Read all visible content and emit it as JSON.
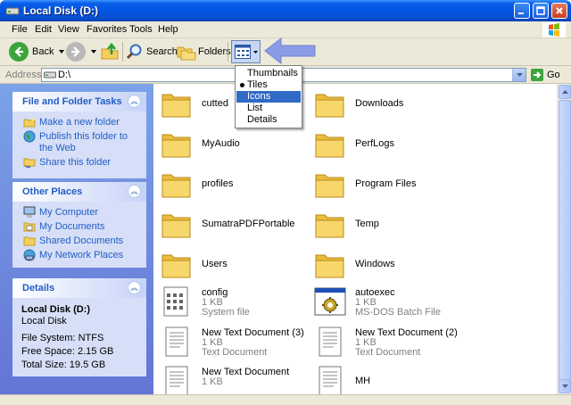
{
  "window": {
    "title": "Local Disk (D:)"
  },
  "menubar": {
    "items": [
      "File",
      "Edit",
      "View",
      "Favorites",
      "Tools",
      "Help"
    ]
  },
  "toolbar": {
    "back_label": "Back",
    "search_label": "Search",
    "folders_label": "Folders"
  },
  "address": {
    "label": "Address",
    "value": "D:\\",
    "go_label": "Go"
  },
  "views_menu": {
    "items": [
      "Thumbnails",
      "Tiles",
      "Icons",
      "List",
      "Details"
    ],
    "checked": "Tiles",
    "highlighted": "Icons"
  },
  "tasks": {
    "title": "File and Folder Tasks",
    "links": [
      "Make a new folder",
      "Publish this folder to the Web",
      "Share this folder"
    ]
  },
  "other_places": {
    "title": "Other Places",
    "links": [
      "My Computer",
      "My Documents",
      "Shared Documents",
      "My Network Places"
    ]
  },
  "details": {
    "title": "Details",
    "name": "Local Disk (D:)",
    "type": "Local Disk",
    "filesystem": "File System: NTFS",
    "free": "Free Space: 2.15 GB",
    "total": "Total Size: 19.5 GB"
  },
  "items": [
    {
      "name": "cutted",
      "kind": "folder"
    },
    {
      "name": "Downloads",
      "kind": "folder"
    },
    {
      "name": "MyAudio",
      "kind": "folder"
    },
    {
      "name": "PerfLogs",
      "kind": "folder"
    },
    {
      "name": "profiles",
      "kind": "folder"
    },
    {
      "name": "Program Files",
      "kind": "folder"
    },
    {
      "name": "SumatraPDFPortable",
      "kind": "folder"
    },
    {
      "name": "Temp",
      "kind": "folder"
    },
    {
      "name": "Users",
      "kind": "folder"
    },
    {
      "name": "Windows",
      "kind": "folder"
    },
    {
      "name": "config",
      "kind": "sysfile",
      "size": "1 KB",
      "type": "System file"
    },
    {
      "name": "autoexec",
      "kind": "batch",
      "size": "1 KB",
      "type": "MS-DOS Batch File"
    },
    {
      "name": "New Text Document (3)",
      "kind": "text",
      "size": "1 KB",
      "type": "Text Document"
    },
    {
      "name": "New Text Document (2)",
      "kind": "text",
      "size": "1 KB",
      "type": "Text Document"
    },
    {
      "name": "New Text Document",
      "kind": "text",
      "size": "1 KB",
      "type": ""
    },
    {
      "name": "MH",
      "kind": "text",
      "size": "",
      "type": ""
    }
  ],
  "colors": {
    "title_blue": "#0054e3",
    "link_blue": "#215dc6",
    "selection": "#316ac5",
    "annotation_arrow": "#8c9be8"
  }
}
